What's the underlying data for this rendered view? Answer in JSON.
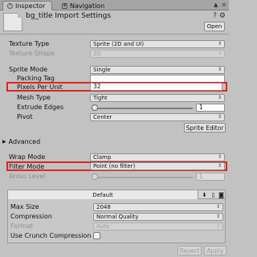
{
  "tabs": [
    {
      "label": "Inspector",
      "active": true
    },
    {
      "label": "Navigation",
      "active": false
    }
  ],
  "header": {
    "title": "bg_title Import Settings",
    "open_label": "Open"
  },
  "fields": {
    "texture_type": {
      "label": "Texture Type",
      "value": "Sprite (2D and UI)"
    },
    "texture_shape": {
      "label": "Texture Shape",
      "value": "2D"
    },
    "sprite_mode": {
      "label": "Sprite Mode",
      "value": "Single"
    },
    "packing_tag": {
      "label": "Packing Tag",
      "value": ""
    },
    "pixels_per_unit": {
      "label": "Pixels Per Unit",
      "value": "32"
    },
    "mesh_type": {
      "label": "Mesh Type",
      "value": "Tight"
    },
    "extrude_edges": {
      "label": "Extrude Edges",
      "value": "1"
    },
    "pivot": {
      "label": "Pivot",
      "value": "Center"
    },
    "sprite_editor_label": "Sprite Editor",
    "advanced_label": "Advanced",
    "wrap_mode": {
      "label": "Wrap Mode",
      "value": "Clamp"
    },
    "filter_mode": {
      "label": "Filter Mode",
      "value": "Point (no filter)"
    },
    "aniso_level": {
      "label": "Aniso Level",
      "value": "1"
    }
  },
  "platform": {
    "default_tab": "Default",
    "icons": [
      "download-icon",
      "mobile-icon",
      "android-icon"
    ],
    "max_size": {
      "label": "Max Size",
      "value": "2048"
    },
    "compression": {
      "label": "Compression",
      "value": "Normal Quality"
    },
    "format": {
      "label": "Format",
      "value": "Auto"
    },
    "crunch": {
      "label": "Use Crunch Compression",
      "checked": false
    }
  },
  "footer": {
    "revert_label": "Revert",
    "apply_label": "Apply"
  },
  "colors": {
    "highlight": "#e0241c",
    "background": "#c2c2c2"
  }
}
